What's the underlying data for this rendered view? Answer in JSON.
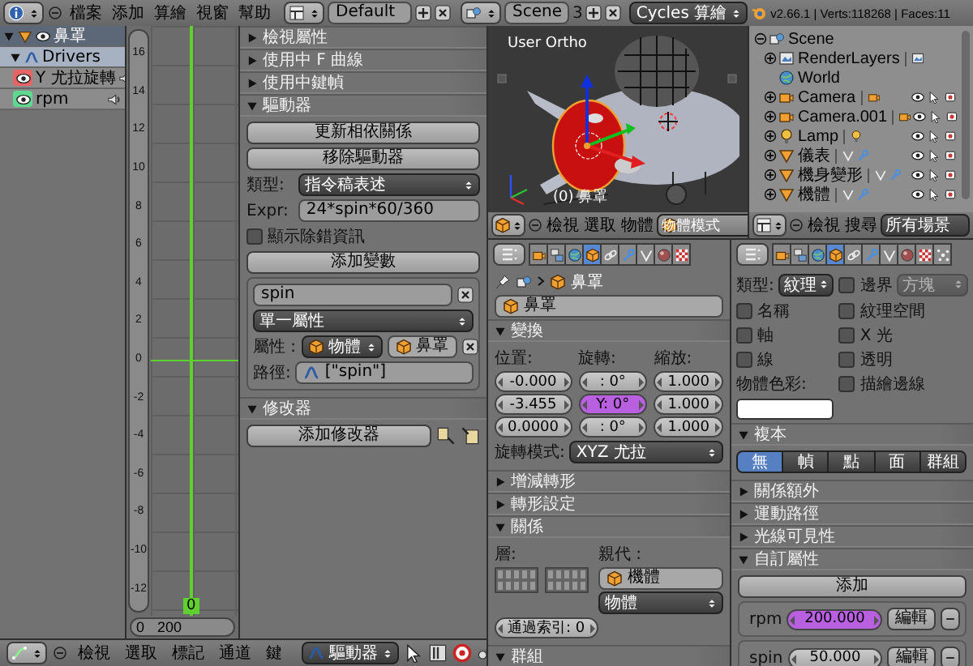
{
  "top_bar": {
    "menus": [
      "檔案",
      "添加",
      "算繪",
      "視窗",
      "幫助"
    ],
    "layout": "Default",
    "scene": "Scene",
    "scene_users": "3",
    "engine": "Cycles 算繪",
    "stats": "v2.66.1 | Verts:118268 | Faces:11"
  },
  "channels": [
    {
      "name": "鼻罩",
      "kind": "object",
      "expanded": true,
      "children": [
        {
          "name": "Drivers",
          "kind": "drivers",
          "expanded": true,
          "children": [
            {
              "name": "Y 尤拉旋轉",
              "kind": "fcurve",
              "color": "#e86464"
            },
            {
              "name": "rpm",
              "kind": "fcurve",
              "color": "#5fd890"
            }
          ]
        }
      ]
    }
  ],
  "graph": {
    "y_labels": [
      "16",
      "14",
      "12",
      "10",
      "8",
      "6",
      "4",
      "2",
      "0",
      "-2",
      "-4",
      "-6",
      "-8",
      "-10",
      "-12"
    ],
    "frame": "0",
    "x_labels": [
      "0",
      "200"
    ]
  },
  "driver_panels": [
    {
      "title": "檢視屬性",
      "expanded": false
    },
    {
      "title": "使用中 F 曲線",
      "expanded": false
    },
    {
      "title": "使用中鍵幀",
      "expanded": false
    },
    {
      "title": "驅動器",
      "expanded": true,
      "kind": "driver"
    },
    {
      "title": "修改器",
      "expanded": true,
      "kind": "modifiers"
    }
  ],
  "driver": {
    "update_button": "更新相依關係",
    "remove_button": "移除驅動器",
    "type_label": "類型:",
    "type": "指令稿表述",
    "expr_label": "Expr:",
    "expr": "24*spin*60/360",
    "debug": {
      "label": "顯示除錯資訊",
      "checked": false
    },
    "add_variable": "添加變數",
    "variable": {
      "name": "spin",
      "type": "單一屬性",
      "prop_label": "屬性 :",
      "id_type": "物體",
      "id": "鼻罩",
      "path_label": "路徑:",
      "path": "[\"spin\"]"
    }
  },
  "modifiers": {
    "add_button": "添加修改器"
  },
  "graph_header": {
    "menus": [
      "檢視",
      "選取",
      "標記",
      "通道",
      "鍵"
    ],
    "mode": "驅動器"
  },
  "view3d": {
    "view_name": "User Ortho",
    "object_label": "(0) 鼻罩",
    "menus": [
      "檢視",
      "選取",
      "物體"
    ],
    "mode": "物體模式"
  },
  "outliner": {
    "items": [
      {
        "name": "Scene",
        "kind": "scene",
        "expanded": true,
        "children": [
          {
            "name": "RenderLayers",
            "kind": "renderlayers",
            "expanded": false
          },
          {
            "name": "World",
            "kind": "world"
          },
          {
            "name": "Camera",
            "kind": "camera",
            "expanded": false
          },
          {
            "name": "Camera.001",
            "kind": "camera",
            "expanded": false
          },
          {
            "name": "Lamp",
            "kind": "lamp",
            "expanded": false
          },
          {
            "name": "儀表",
            "kind": "mesh",
            "expanded": false
          },
          {
            "name": "機身變形",
            "kind": "mesh",
            "expanded": false
          },
          {
            "name": "機體",
            "kind": "mesh",
            "expanded": false
          }
        ]
      }
    ],
    "menus": [
      "檢視",
      "搜尋"
    ],
    "filter": "所有場景"
  },
  "props_object": {
    "tabs": [
      {
        "kind": "render",
        "selected": false
      },
      {
        "kind": "layers",
        "selected": false
      },
      {
        "kind": "world",
        "selected": false
      },
      {
        "kind": "object",
        "selected": true
      },
      {
        "kind": "constraint",
        "selected": false
      },
      {
        "kind": "modifier",
        "selected": false
      },
      {
        "kind": "data",
        "selected": false
      },
      {
        "kind": "material",
        "selected": false
      },
      {
        "kind": "texture",
        "selected": false
      }
    ],
    "breadcrumb": "鼻罩",
    "name": "鼻罩",
    "panels": [
      {
        "title": "變換",
        "expanded": true,
        "kind": "transform"
      },
      {
        "title": "增減轉形",
        "expanded": false
      },
      {
        "title": "轉形設定",
        "expanded": false
      },
      {
        "title": "關係",
        "expanded": true,
        "kind": "relations"
      },
      {
        "title": "群組",
        "expanded": true
      }
    ],
    "transform": {
      "columns": [
        {
          "label": "位置:",
          "fields": [
            {
              "value": "-0.000",
              "driven": false
            },
            {
              "value": "-3.455",
              "driven": false
            },
            {
              "value": "0.0000",
              "driven": false
            }
          ]
        },
        {
          "label": "旋轉:",
          "fields": [
            {
              "value": ": 0°",
              "driven": false
            },
            {
              "value": "Y: 0°",
              "driven": true
            },
            {
              "value": ": 0°",
              "driven": false
            }
          ]
        },
        {
          "label": "縮放:",
          "fields": [
            {
              "value": "1.000",
              "driven": false
            },
            {
              "value": "1.000",
              "driven": false
            },
            {
              "value": "1.000",
              "driven": false
            }
          ]
        }
      ],
      "rotation_mode_label": "旋轉模式:",
      "rotation_mode": "XYZ 尤拉"
    },
    "relations": {
      "layers_label": "層:",
      "parent_label": "親代 :",
      "parent": "機體",
      "parent_type": "物體",
      "pass_index": "通過索引: 0"
    }
  },
  "props_display": {
    "tabs": [
      {
        "kind": "render",
        "selected": false
      },
      {
        "kind": "layers",
        "selected": false
      },
      {
        "kind": "world",
        "selected": false
      },
      {
        "kind": "object",
        "selected": true
      },
      {
        "kind": "constraint",
        "selected": false
      },
      {
        "kind": "modifier",
        "selected": false
      },
      {
        "kind": "data",
        "selected": false
      },
      {
        "kind": "material",
        "selected": false
      },
      {
        "kind": "texture",
        "selected": false
      },
      {
        "kind": "particles",
        "selected": false
      }
    ],
    "type_label": "類型:",
    "type": "紋理",
    "bounds": {
      "label": "邊界",
      "checked": false
    },
    "bounds_type": "方塊",
    "left_checks": [
      {
        "label": "名稱",
        "checked": false
      },
      {
        "label": "軸",
        "checked": false
      },
      {
        "label": "線",
        "checked": false
      }
    ],
    "right_checks": [
      {
        "label": "紋理空間",
        "checked": false
      },
      {
        "label": "X 光",
        "checked": false
      },
      {
        "label": "透明",
        "checked": false
      },
      {
        "label": "描繪邊線",
        "checked": false
      }
    ],
    "color_label": "物體色彩:",
    "color": "#ffffff",
    "panels": [
      {
        "title": "複本",
        "expanded": true,
        "kind": "dupli"
      },
      {
        "title": "關係額外",
        "expanded": false
      },
      {
        "title": "運動路徑",
        "expanded": false
      },
      {
        "title": "光線可見性",
        "expanded": false
      },
      {
        "title": "自訂屬性",
        "expanded": true,
        "kind": "custom"
      }
    ],
    "dupli": [
      {
        "label": "無",
        "selected": true
      },
      {
        "label": "幀",
        "selected": false
      },
      {
        "label": "點",
        "selected": false
      },
      {
        "label": "面",
        "selected": false
      },
      {
        "label": "群組",
        "selected": false
      }
    ],
    "custom": {
      "add_button": "添加",
      "properties": [
        {
          "name": "rpm",
          "value": "200.000",
          "driven": true,
          "edit": "編輯"
        },
        {
          "name": "spin",
          "value": "50.000",
          "driven": false,
          "edit": "編輯"
        }
      ]
    }
  }
}
